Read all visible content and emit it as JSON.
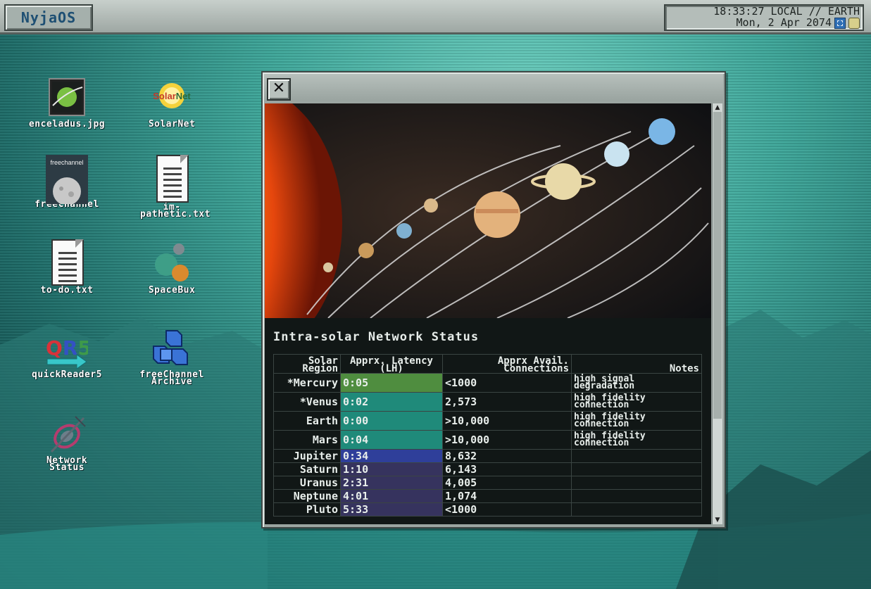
{
  "topbar": {
    "os_name": "NyjaOS",
    "clock_line1": "18:33:27 LOCAL // EARTH",
    "clock_line2": "Mon, 2 Apr 2074"
  },
  "desktop_icons": [
    {
      "label": "enceladus.jpg",
      "icon": "image-file-icon"
    },
    {
      "label": "SolarNet",
      "icon": "solarnet-logo-icon"
    },
    {
      "label": "freeChannel",
      "icon": "freechannel-app-icon",
      "art_text": "freechannel"
    },
    {
      "label": "im-pathetic.txt",
      "icon": "text-file-icon"
    },
    {
      "label": "to-do.txt",
      "icon": "text-file-icon"
    },
    {
      "label": "SpaceBux",
      "icon": "spacebux-app-icon"
    },
    {
      "label": "quickReader5",
      "icon": "quickreader-app-icon",
      "art_text": "QR5"
    },
    {
      "label": "freeChannel Archive",
      "icon": "archive-cubes-icon"
    },
    {
      "label": "Network Status",
      "icon": "satellite-icon"
    }
  ],
  "window": {
    "close_label": "✕",
    "heading": "Intra-solar Network Status",
    "columns": [
      "Solar Region",
      "Apprx. Latency (LH)",
      "Apprx Avail. Connections",
      "Notes"
    ],
    "rows": [
      {
        "region": "*Mercury",
        "latency": "0:05",
        "connections": "<1000",
        "notes": "high signal degradation",
        "bar_color": "#4f8d3f"
      },
      {
        "region": "*Venus",
        "latency": "0:02",
        "connections": "2,573",
        "notes": "high fidelity connection",
        "bar_color": "#1f8a7a"
      },
      {
        "region": "Earth",
        "latency": "0:00",
        "connections": ">10,000",
        "notes": "high fidelity connection",
        "bar_color": "#1f8a7a"
      },
      {
        "region": "Mars",
        "latency": "0:04",
        "connections": ">10,000",
        "notes": "high fidelity connection",
        "bar_color": "#1f8a7a"
      },
      {
        "region": "Jupiter",
        "latency": "0:34",
        "connections": "8,632",
        "notes": "",
        "bar_color": "#2f3f9a"
      },
      {
        "region": "Saturn",
        "latency": "1:10",
        "connections": "6,143",
        "notes": "",
        "bar_color": "#36335e"
      },
      {
        "region": "Uranus",
        "latency": "2:31",
        "connections": "4,005",
        "notes": "",
        "bar_color": "#36335e"
      },
      {
        "region": "Neptune",
        "latency": "4:01",
        "connections": "1,074",
        "notes": "",
        "bar_color": "#36335e"
      },
      {
        "region": "Pluto",
        "latency": "5:33",
        "connections": "<1000",
        "notes": "",
        "bar_color": "#36335e"
      }
    ]
  }
}
